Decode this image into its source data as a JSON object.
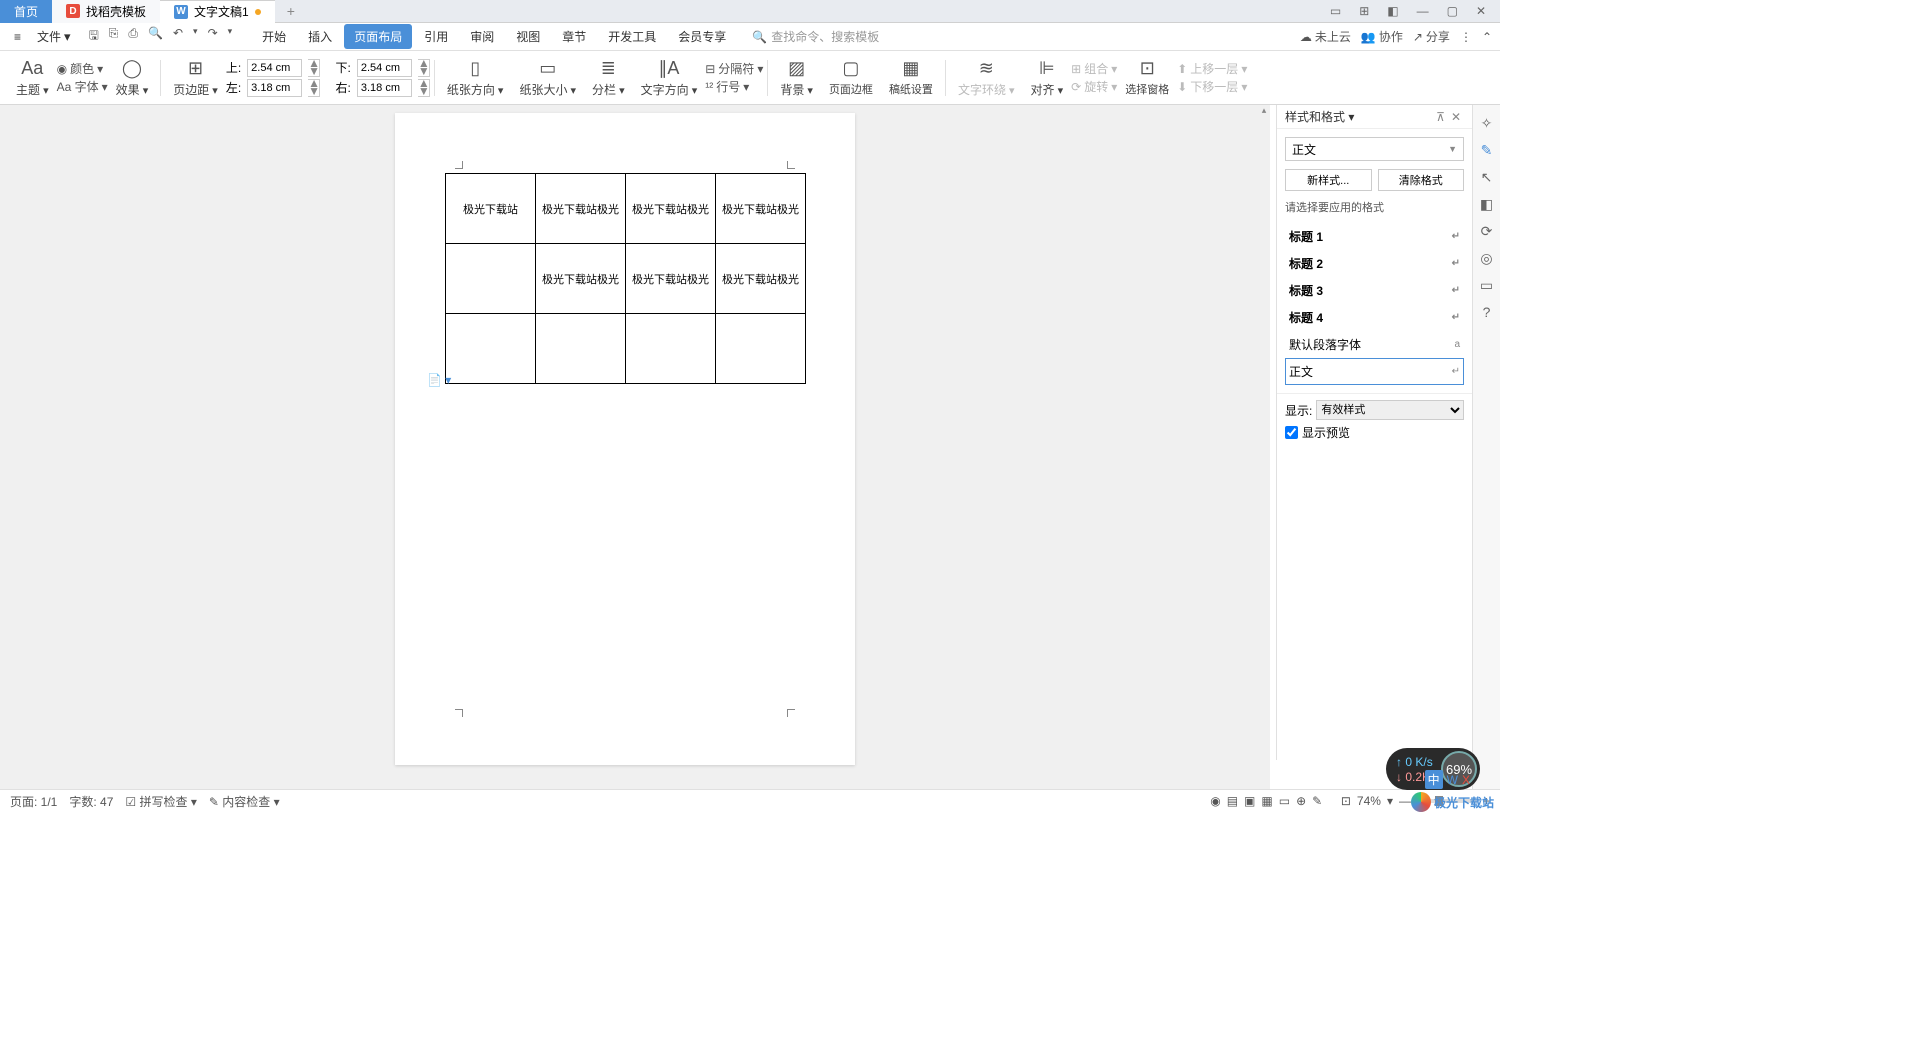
{
  "tabs": {
    "home": "首页",
    "template": "找稻壳模板",
    "doc": "文字文稿1"
  },
  "menu": {
    "file": "文件",
    "tabs": [
      "开始",
      "插入",
      "页面布局",
      "引用",
      "审阅",
      "视图",
      "章节",
      "开发工具",
      "会员专享"
    ],
    "activeTab": "页面布局",
    "searchPlaceholder": "查找命令、搜索模板",
    "cloud": "未上云",
    "collab": "协作",
    "share": "分享"
  },
  "ribbon": {
    "theme": "主题",
    "color": "颜色",
    "font": "Aa 字体",
    "effect": "效果",
    "watermark": "⊡",
    "margins": "页边距",
    "top": "上:",
    "topVal": "2.54 cm",
    "bottom": "下:",
    "botVal": "2.54 cm",
    "left": "左:",
    "leftVal": "3.18 cm",
    "right": "右:",
    "rightVal": "3.18 cm",
    "orientation": "纸张方向",
    "size": "纸张大小",
    "columns": "分栏",
    "textDir": "文字方向",
    "breaks": "分隔符",
    "lineNum": "行号",
    "bg": "背景",
    "border": "页面边框",
    "paperSetup": "稿纸设置",
    "textWrap": "文字环绕",
    "align": "对齐",
    "rotate": "旋转",
    "group": "组合",
    "selPane": "选择窗格",
    "moveUp": "上移一层",
    "moveDown": "下移一层"
  },
  "table": {
    "rows": [
      [
        "极光下载站",
        "极光下载站极光",
        "极光下载站极光",
        "极光下载站极光"
      ],
      [
        "",
        "极光下载站极光",
        "极光下载站极光",
        "极光下载站极光"
      ],
      [
        "",
        "",
        "",
        ""
      ]
    ]
  },
  "pane": {
    "title": "样式和格式",
    "currentStyle": "正文",
    "newStyle": "新样式...",
    "clearFmt": "清除格式",
    "pickLabel": "请选择要应用的格式",
    "styles": [
      {
        "label": "标题 1",
        "cls": "h1"
      },
      {
        "label": "标题 2",
        "cls": "h2"
      },
      {
        "label": "标题 3",
        "cls": "h3"
      },
      {
        "label": "标题 4",
        "cls": "h4"
      },
      {
        "label": "默认段落字体",
        "cls": "",
        "mk": "a"
      },
      {
        "label": "正文",
        "cls": "sel"
      }
    ],
    "showLabel": "显示:",
    "showVal": "有效样式",
    "previewChk": "显示预览"
  },
  "status": {
    "page": "页面: 1/1",
    "words": "字数: 47",
    "spell": "拼写检查",
    "content": "内容检查",
    "zoom": "74%"
  },
  "widget": {
    "up": "0 K/s",
    "down": "0.2K/s",
    "pct": "69%"
  },
  "watermark": "极光下载站",
  "ime": "中"
}
